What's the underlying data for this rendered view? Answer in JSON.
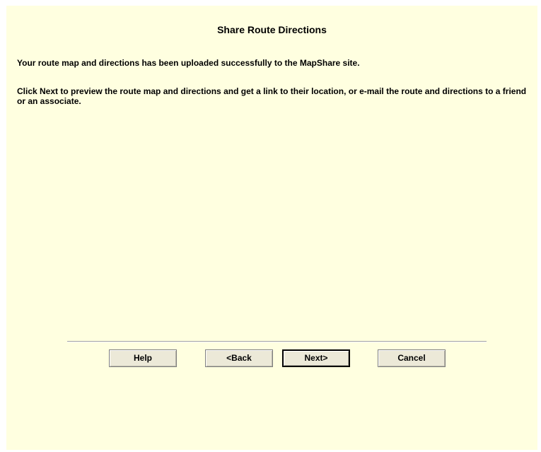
{
  "dialog": {
    "title": "Share Route Directions",
    "message_uploaded": "Your route map and directions has been uploaded successfully to the MapShare site.",
    "message_next": "Click Next to preview the route map and directions and get a link to their location, or e-mail the route and directions to a friend or an associate."
  },
  "buttons": {
    "help": "Help",
    "back": "<Back",
    "next": "Next>",
    "cancel": "Cancel"
  },
  "colors": {
    "panel_background": "#ffffe0",
    "button_face": "#ece9d8",
    "default_button_border": "#000000"
  }
}
